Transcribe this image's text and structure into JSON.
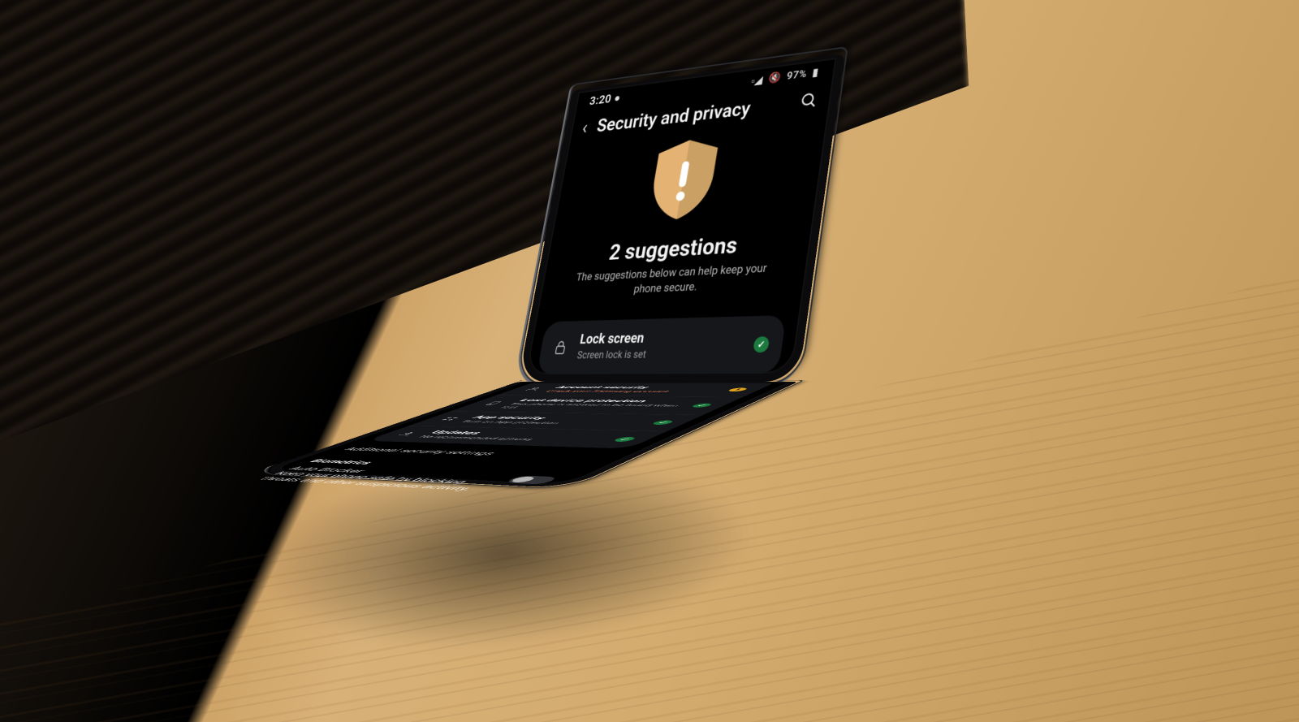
{
  "status_bar": {
    "time": "3:20",
    "battery_text": "97%",
    "icons": [
      "signal",
      "wifi",
      "volume",
      "battery"
    ]
  },
  "header": {
    "title": "Security and privacy"
  },
  "hero": {
    "suggestion_count": "2 suggestions",
    "subtitle": "The suggestions below can help keep your phone secure."
  },
  "card_rows": [
    {
      "icon": "lock",
      "title": "Lock screen",
      "subtitle": "Screen lock is set",
      "sub_warn": false,
      "status": "ok"
    },
    {
      "icon": "account",
      "title": "Account security",
      "subtitle": "Check your Samsung account",
      "sub_warn": true,
      "status": "warn"
    },
    {
      "icon": "device",
      "title": "Lost device protection",
      "subtitle": "This phone is allowed to be found when lost",
      "sub_warn": false,
      "status": "ok"
    },
    {
      "icon": "apps",
      "title": "App security",
      "subtitle": "Turn on App protection",
      "sub_warn": false,
      "status": "ok"
    },
    {
      "icon": "update",
      "title": "Updates",
      "subtitle": "No recommended actions",
      "sub_warn": false,
      "status": "ok"
    }
  ],
  "plain": {
    "additional": "Additional security settings"
  },
  "sections": {
    "biometrics": "Biometrics",
    "auto_blocker_title": "Auto Blocker",
    "auto_blocker_sub": "Keep your phone safe by blocking threats and other suspicious activity."
  },
  "colors": {
    "shield": "#e4b373",
    "shield_dark": "#caa064",
    "ok": "#1c7a3f",
    "warn": "#e0a11d",
    "warn_text": "#ff8a6b"
  }
}
